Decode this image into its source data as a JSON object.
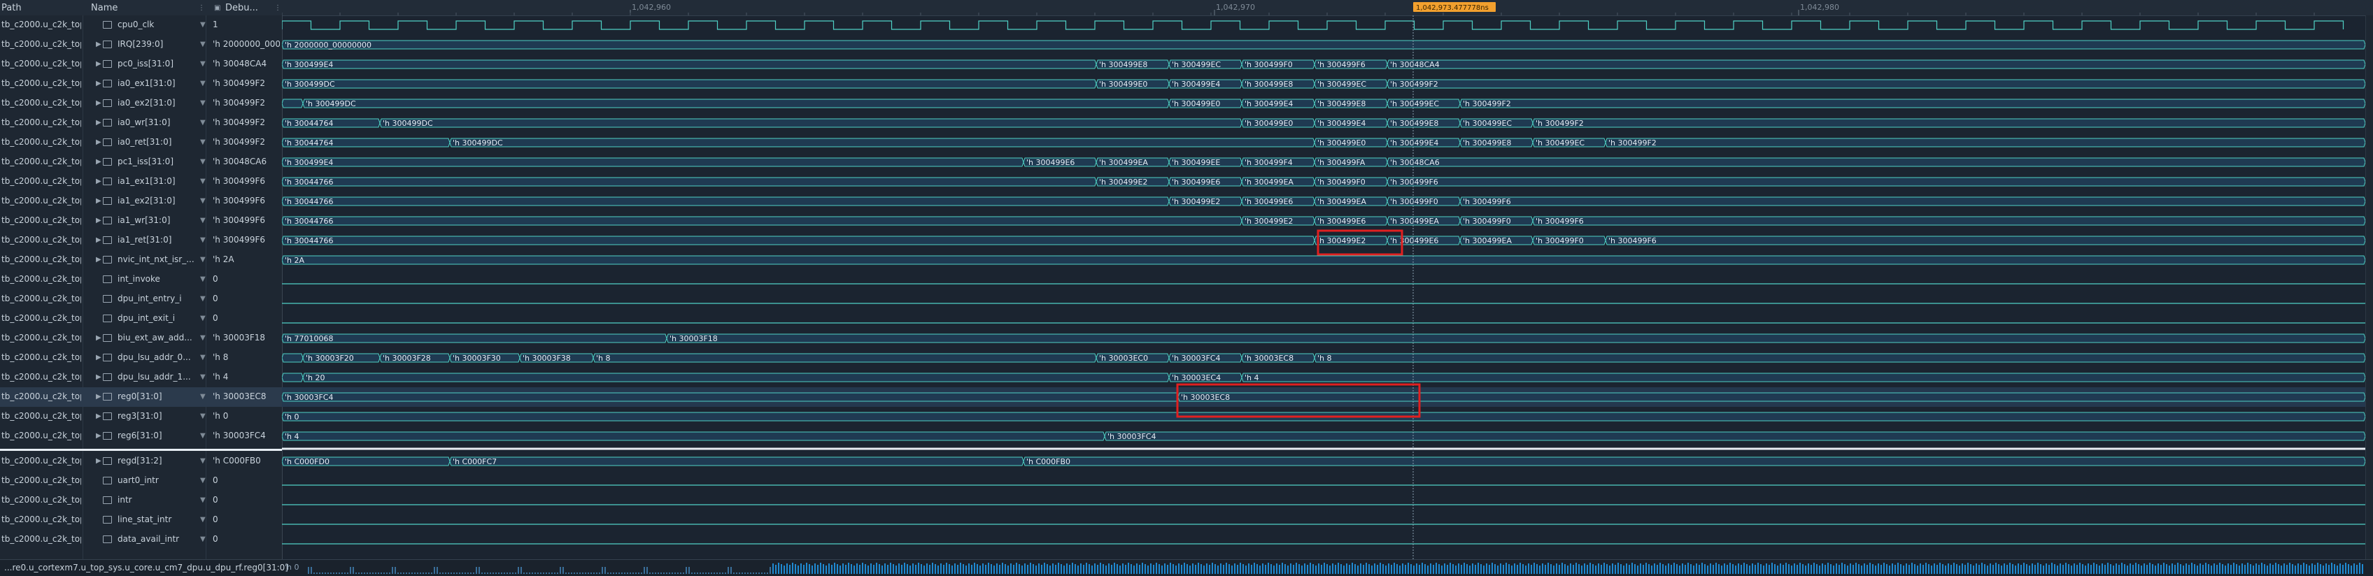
{
  "header": {
    "path_label": "Path",
    "name_label": "Name",
    "value_label": "Debu...",
    "ticks": [
      "1,042,960",
      "1,042,970",
      "1,042,980"
    ],
    "cursor_label": "1,042,973.477778ns"
  },
  "colors": {
    "wave": "#4fd1c5",
    "bus_fill": "#1f3a52",
    "highlight": "#e02020",
    "cursor": "#f2a02e"
  },
  "signals": [
    {
      "path": "tb_c2000.u_c2k_top...",
      "name": "cpu0_clk",
      "icon": "clock-icon",
      "value": "1",
      "type": "clock",
      "expand": false
    },
    {
      "path": "tb_c2000.u_c2k_top...",
      "name": "IRQ[239:0]",
      "icon": "bus-icon",
      "value": "'h 2000000_000...",
      "type": "bus",
      "expand": true,
      "segs": [
        {
          "t": 0,
          "v": "'h 2000000_00000000"
        }
      ]
    },
    {
      "path": "tb_c2000.u_c2k_top...",
      "name": "pc0_iss[31:0]",
      "icon": "bus-icon",
      "value": "'h 30048CA4",
      "type": "bus",
      "expand": true,
      "segs": [
        {
          "t": 0,
          "v": "'h 300499E4"
        },
        {
          "t": 1164,
          "v": "'h 300499E8"
        },
        {
          "t": 1268,
          "v": "'h 300499EC"
        },
        {
          "t": 1372,
          "v": "'h 300499F0"
        },
        {
          "t": 1476,
          "v": "'h 300499F6"
        },
        {
          "t": 1580,
          "v": "'h 30048CA4"
        }
      ]
    },
    {
      "path": "tb_c2000.u_c2k_top...",
      "name": "ia0_ex1[31:0]",
      "icon": "bus-icon",
      "value": "'h 300499F2",
      "type": "bus",
      "expand": true,
      "segs": [
        {
          "t": 0,
          "v": "'h 300499DC"
        },
        {
          "t": 1164,
          "v": "'h 300499E0"
        },
        {
          "t": 1268,
          "v": "'h 300499E4"
        },
        {
          "t": 1372,
          "v": "'h 300499E8"
        },
        {
          "t": 1476,
          "v": "'h 300499EC"
        },
        {
          "t": 1580,
          "v": "'h 300499F2"
        }
      ]
    },
    {
      "path": "tb_c2000.u_c2k_top...",
      "name": "ia0_ex2[31:0]",
      "icon": "bus-icon",
      "value": "'h 300499F2",
      "type": "bus",
      "expand": true,
      "segs": [
        {
          "t": 0,
          "v": "'h ..."
        },
        {
          "t": 30,
          "v": "'h 300499DC"
        },
        {
          "t": 1268,
          "v": "'h 300499E0"
        },
        {
          "t": 1372,
          "v": "'h 300499E4"
        },
        {
          "t": 1476,
          "v": "'h 300499E8"
        },
        {
          "t": 1580,
          "v": "'h 300499EC"
        },
        {
          "t": 1684,
          "v": "'h 300499F2"
        }
      ]
    },
    {
      "path": "tb_c2000.u_c2k_top...",
      "name": "ia0_wr[31:0]",
      "icon": "bus-icon",
      "value": "'h 300499F2",
      "type": "bus",
      "expand": true,
      "segs": [
        {
          "t": 0,
          "v": "'h 30044764"
        },
        {
          "t": 140,
          "v": "'h 300499DC"
        },
        {
          "t": 1372,
          "v": "'h 300499E0"
        },
        {
          "t": 1476,
          "v": "'h 300499E4"
        },
        {
          "t": 1580,
          "v": "'h 300499E8"
        },
        {
          "t": 1684,
          "v": "'h 300499EC"
        },
        {
          "t": 1788,
          "v": "'h 300499F2"
        }
      ]
    },
    {
      "path": "tb_c2000.u_c2k_top...",
      "name": "ia0_ret[31:0]",
      "icon": "bus-icon",
      "value": "'h 300499F2",
      "type": "bus",
      "expand": true,
      "segs": [
        {
          "t": 0,
          "v": "'h 30044764"
        },
        {
          "t": 240,
          "v": "'h 300499DC"
        },
        {
          "t": 1476,
          "v": "'h 300499E0"
        },
        {
          "t": 1580,
          "v": "'h 300499E4"
        },
        {
          "t": 1684,
          "v": "'h 300499E8"
        },
        {
          "t": 1788,
          "v": "'h 300499EC"
        },
        {
          "t": 1892,
          "v": "'h 300499F2"
        }
      ]
    },
    {
      "path": "tb_c2000.u_c2k_top...",
      "name": "pc1_iss[31:0]",
      "icon": "bus-icon",
      "value": "'h 30048CA6",
      "type": "bus",
      "expand": true,
      "segs": [
        {
          "t": 0,
          "v": "'h 300499E4"
        },
        {
          "t": 1060,
          "v": "'h 300499E6"
        },
        {
          "t": 1164,
          "v": "'h 300499EA"
        },
        {
          "t": 1268,
          "v": "'h 300499EE"
        },
        {
          "t": 1372,
          "v": "'h 300499F4"
        },
        {
          "t": 1476,
          "v": "'h 300499FA"
        },
        {
          "t": 1580,
          "v": "'h 30048CA6"
        }
      ]
    },
    {
      "path": "tb_c2000.u_c2k_top...",
      "name": "ia1_ex1[31:0]",
      "icon": "bus-icon",
      "value": "'h 300499F6",
      "type": "bus",
      "expand": true,
      "segs": [
        {
          "t": 0,
          "v": "'h 30044766"
        },
        {
          "t": 1164,
          "v": "'h 300499E2"
        },
        {
          "t": 1268,
          "v": "'h 300499E6"
        },
        {
          "t": 1372,
          "v": "'h 300499EA"
        },
        {
          "t": 1476,
          "v": "'h 300499F0"
        },
        {
          "t": 1580,
          "v": "'h 300499F6"
        }
      ]
    },
    {
      "path": "tb_c2000.u_c2k_top...",
      "name": "ia1_ex2[31:0]",
      "icon": "bus-icon",
      "value": "'h 300499F6",
      "type": "bus",
      "expand": true,
      "segs": [
        {
          "t": 0,
          "v": "'h 30044766"
        },
        {
          "t": 1268,
          "v": "'h 300499E2"
        },
        {
          "t": 1372,
          "v": "'h 300499E6"
        },
        {
          "t": 1476,
          "v": "'h 300499EA"
        },
        {
          "t": 1580,
          "v": "'h 300499F0"
        },
        {
          "t": 1684,
          "v": "'h 300499F6"
        }
      ]
    },
    {
      "path": "tb_c2000.u_c2k_top...",
      "name": "ia1_wr[31:0]",
      "icon": "bus-icon",
      "value": "'h 300499F6",
      "type": "bus",
      "expand": true,
      "segs": [
        {
          "t": 0,
          "v": "'h 30044766"
        },
        {
          "t": 1372,
          "v": "'h 300499E2"
        },
        {
          "t": 1476,
          "v": "'h 300499E6"
        },
        {
          "t": 1580,
          "v": "'h 300499EA"
        },
        {
          "t": 1684,
          "v": "'h 300499F0"
        },
        {
          "t": 1788,
          "v": "'h 300499F6"
        }
      ]
    },
    {
      "path": "tb_c2000.u_c2k_top...",
      "name": "ia1_ret[31:0]",
      "icon": "bus-icon",
      "value": "'h 300499F6",
      "type": "bus",
      "expand": true,
      "segs": [
        {
          "t": 0,
          "v": "'h 30044766"
        },
        {
          "t": 1476,
          "v": "'h 300499E2"
        },
        {
          "t": 1580,
          "v": "'h 300499E6"
        },
        {
          "t": 1684,
          "v": "'h 300499EA"
        },
        {
          "t": 1788,
          "v": "'h 300499F0"
        },
        {
          "t": 1892,
          "v": "'h 300499F6"
        }
      ]
    },
    {
      "path": "tb_c2000.u_c2k_top...",
      "name": "nvic_int_nxt_isr_...",
      "icon": "bus-icon",
      "value": "'h 2A",
      "type": "bus",
      "expand": true,
      "segs": [
        {
          "t": 0,
          "v": "'h 2A"
        }
      ]
    },
    {
      "path": "tb_c2000.u_c2k_top...",
      "name": "int_invoke",
      "icon": "bit-icon",
      "value": "0",
      "type": "low",
      "expand": false
    },
    {
      "path": "tb_c2000.u_c2k_top...",
      "name": "dpu_int_entry_i",
      "icon": "input-icon",
      "value": "0",
      "type": "low",
      "expand": false
    },
    {
      "path": "tb_c2000.u_c2k_top...",
      "name": "dpu_int_exit_i",
      "icon": "input-icon",
      "value": "0",
      "type": "low",
      "expand": false
    },
    {
      "path": "tb_c2000.u_c2k_top...",
      "name": "biu_ext_aw_add...",
      "icon": "bus-icon",
      "value": "'h 30003F18",
      "type": "bus",
      "expand": true,
      "segs": [
        {
          "t": 0,
          "v": "'h 77010068"
        },
        {
          "t": 550,
          "v": "'h 30003F18"
        }
      ]
    },
    {
      "path": "tb_c2000.u_c2k_top...",
      "name": "dpu_lsu_addr_0...",
      "icon": "bus-icon",
      "value": "'h 8",
      "type": "bus",
      "expand": true,
      "segs": [
        {
          "t": 0,
          "v": "'h ..."
        },
        {
          "t": 30,
          "v": "'h 30003F20"
        },
        {
          "t": 140,
          "v": "'h 30003F28"
        },
        {
          "t": 240,
          "v": "'h 30003F30"
        },
        {
          "t": 340,
          "v": "'h 30003F38"
        },
        {
          "t": 445,
          "v": "'h 8"
        },
        {
          "t": 1164,
          "v": "'h 30003EC0"
        },
        {
          "t": 1268,
          "v": "'h 30003FC4"
        },
        {
          "t": 1372,
          "v": "'h 30003EC8"
        },
        {
          "t": 1476,
          "v": "'h 8"
        }
      ]
    },
    {
      "path": "tb_c2000.u_c2k_top...",
      "name": "dpu_lsu_addr_1...",
      "icon": "bus-icon",
      "value": "'h 4",
      "type": "bus",
      "expand": true,
      "segs": [
        {
          "t": 0,
          "v": "'h ..."
        },
        {
          "t": 30,
          "v": "'h 20"
        },
        {
          "t": 1268,
          "v": "'h 30003EC4"
        },
        {
          "t": 1372,
          "v": "'h 4"
        }
      ]
    },
    {
      "path": "tb_c2000.u_c2k_top...",
      "name": "reg0[31:0]",
      "icon": "bus-icon",
      "value": "'h 30003EC8",
      "type": "bus",
      "expand": true,
      "selected": true,
      "segs": [
        {
          "t": 0,
          "v": "'h 30003FC4"
        },
        {
          "t": 1281,
          "v": "'h 30003EC8"
        }
      ]
    },
    {
      "path": "tb_c2000.u_c2k_top...",
      "name": "reg3[31:0]",
      "icon": "bus-icon",
      "value": "'h 0",
      "type": "bus",
      "expand": true,
      "segs": [
        {
          "t": 0,
          "v": "'h 0"
        }
      ]
    },
    {
      "path": "tb_c2000.u_c2k_top...",
      "name": "reg6[31:0]",
      "icon": "bus-icon",
      "value": "'h 30003FC4",
      "type": "bus",
      "expand": true,
      "segs": [
        {
          "t": 0,
          "v": "'h 4"
        },
        {
          "t": 1176,
          "v": "'h 30003FC4"
        }
      ]
    },
    {
      "path": "tb_c2000.u_c2k_top...",
      "name": "regd[31:2]",
      "icon": "bus-icon",
      "value": "'h C000FB0",
      "type": "bus",
      "expand": true,
      "segs": [
        {
          "t": 0,
          "v": "'h C000FD0"
        },
        {
          "t": 240,
          "v": "'h C000FC7"
        },
        {
          "t": 1060,
          "v": "'h C000FB0"
        }
      ]
    },
    {
      "path": "tb_c2000.u_c2k_top...",
      "name": "uart0_intr",
      "icon": "bit-icon",
      "value": "0",
      "type": "low",
      "expand": false
    },
    {
      "path": "tb_c2000.u_c2k_top...",
      "name": "intr",
      "icon": "bit-icon",
      "value": "0",
      "type": "low",
      "expand": false
    },
    {
      "path": "tb_c2000.u_c2k_top...",
      "name": "line_stat_intr",
      "icon": "bit-icon",
      "value": "0",
      "type": "low",
      "expand": false
    },
    {
      "path": "tb_c2000.u_c2k_top...",
      "name": "data_avail_intr",
      "icon": "bit-icon",
      "value": "0",
      "type": "low",
      "expand": false
    }
  ],
  "status": {
    "path": "...re0.u_cortexm7.u_top_sys.u_core.u_cm7_dpu.u_dpu_rf.reg0[31:0]",
    "value": "'h 0"
  }
}
